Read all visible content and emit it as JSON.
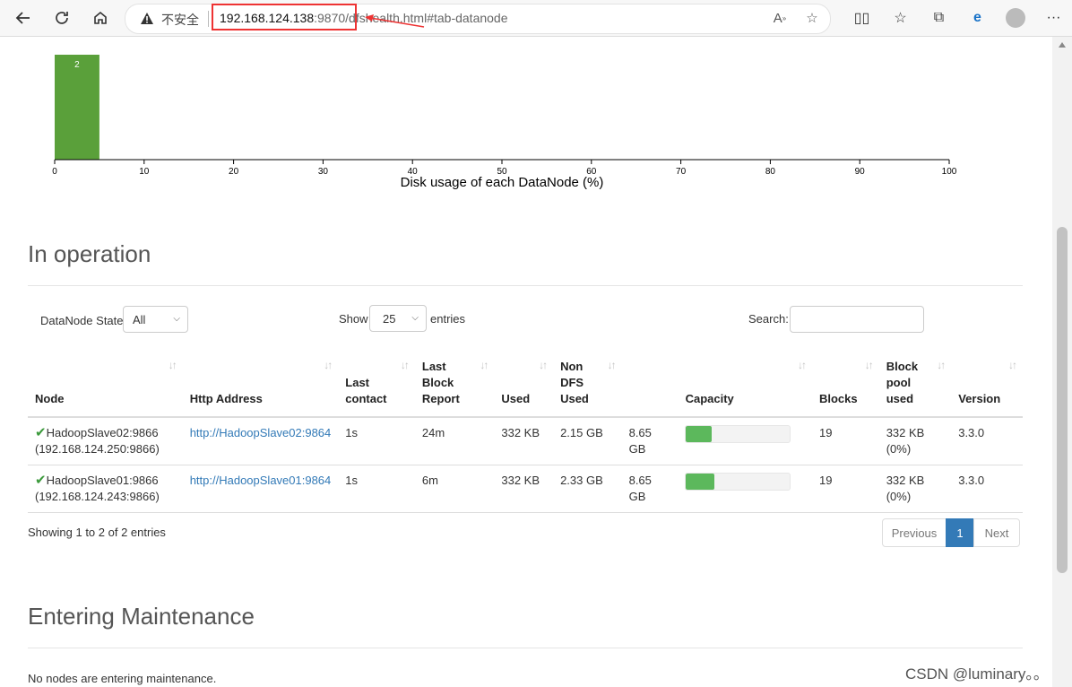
{
  "browser": {
    "insecure_label": "不安全",
    "url_host": "192.168.124.138",
    "url_rest": ":9870/dfshealth.html#tab-datanode"
  },
  "chart_data": {
    "type": "bar",
    "title": "",
    "xlabel": "Disk usage of each DataNode (%)",
    "ylabel": "",
    "x_ticks": [
      0,
      10,
      20,
      30,
      40,
      50,
      60,
      70,
      80,
      90,
      100
    ],
    "xlim": [
      0,
      100
    ],
    "bins": [
      {
        "x0": 0,
        "x1": 5,
        "value": 2
      }
    ],
    "bar_color": "#5aa03a"
  },
  "in_operation": {
    "title": "In operation",
    "state_label": "DataNode State",
    "state_value": "All",
    "show_label": "Show",
    "show_value": "25",
    "entries_label": "entries",
    "search_label": "Search:",
    "columns": {
      "node": "Node",
      "http": "Http Address",
      "last_contact_1": "Last",
      "last_contact_2": "contact",
      "lbr_1": "Last",
      "lbr_2": "Block",
      "lbr_3": "Report",
      "used": "Used",
      "nondfs_1": "Non",
      "nondfs_2": "DFS",
      "nondfs_3": "Used",
      "capacity": "Capacity",
      "blocks": "Blocks",
      "bpu_1": "Block",
      "bpu_2": "pool",
      "bpu_3": "used",
      "version": "Version"
    },
    "rows": [
      {
        "node": "HadoopSlave02:9866",
        "node_ip": "(192.168.124.250:9866)",
        "http": "http://HadoopSlave02:9864",
        "last_contact": "1s",
        "last_block_report": "24m",
        "used": "332 KB",
        "non_dfs": "2.15 GB",
        "capacity": "8.65 GB",
        "capacity_used_fraction": 0.25,
        "blocks": "19",
        "bp_used": "332 KB",
        "bp_pct": "(0%)",
        "version": "3.3.0"
      },
      {
        "node": "HadoopSlave01:9866",
        "node_ip": "(192.168.124.243:9866)",
        "http": "http://HadoopSlave01:9864",
        "last_contact": "1s",
        "last_block_report": "6m",
        "used": "332 KB",
        "non_dfs": "2.33 GB",
        "capacity": "8.65 GB",
        "capacity_used_fraction": 0.27,
        "blocks": "19",
        "bp_used": "332 KB",
        "bp_pct": "(0%)",
        "version": "3.3.0"
      }
    ],
    "info": "Showing 1 to 2 of 2 entries",
    "pager": {
      "prev": "Previous",
      "current": "1",
      "next": "Next"
    }
  },
  "maintenance": {
    "title": "Entering Maintenance",
    "empty": "No nodes are entering maintenance."
  },
  "watermark": "CSDN @luminary。。"
}
